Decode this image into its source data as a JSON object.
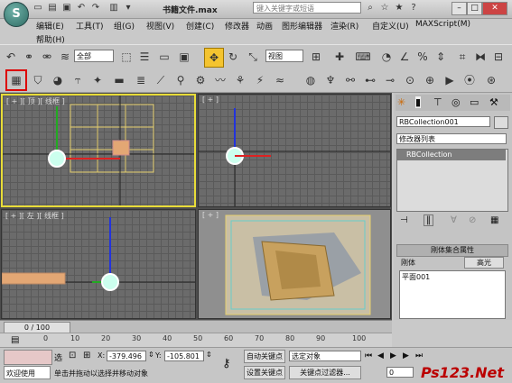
{
  "title_bar": {
    "doc_title": "书籍文件.max",
    "search_placeholder": "键入关键字或短语"
  },
  "menu": {
    "row1": [
      "编辑(E)",
      "工具(T)",
      "组(G)",
      "视图(V)",
      "创建(C)",
      "修改器",
      "动画",
      "图形编辑器",
      "渲染(R)",
      "自定义(U)",
      "MAXScript(M)"
    ],
    "row2": [
      "帮助(H)"
    ]
  },
  "toolbar1": {
    "selection_filter": "全部",
    "ref_coord": "视图"
  },
  "viewports": {
    "top": "[ + ][ 顶 ][ 线框 ]",
    "front": "[ + ]",
    "left": "[ + ][ 左 ][ 线框 ]",
    "persp": "[ + ]"
  },
  "command_panel": {
    "object_name": "RBCollection001",
    "modifier_list": "修改器列表",
    "stack_item": "RBCollection",
    "rollout_title": "刚体集合属性",
    "col_rigid": "刚体",
    "col_highlight": "高光",
    "list_item": "平面001"
  },
  "timeline": {
    "frame_counter": "0 / 100",
    "ticks": [
      "0",
      "10",
      "20",
      "30",
      "40",
      "50",
      "60",
      "70",
      "80",
      "90",
      "100"
    ]
  },
  "status": {
    "welcome": "欢迎使用",
    "selected": "选",
    "x_label": "X:",
    "x_value": "-379.496",
    "y_label": "Y:",
    "y_value": "-105.801",
    "z_label": "Z:",
    "prompt": "单击并拖动以选择并移动对象",
    "auto_key": "自动关键点",
    "set_key": "设置关键点",
    "key_mode": "选定对象",
    "key_filters": "关键点过滤器...",
    "frame": "0"
  },
  "watermark": "Ps123.Net"
}
